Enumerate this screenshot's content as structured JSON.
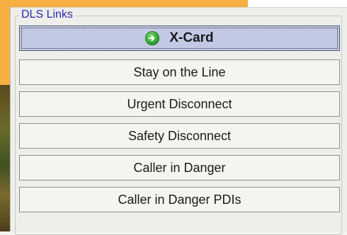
{
  "panel": {
    "legend": "DLS Links"
  },
  "buttons": [
    {
      "label": "X-Card",
      "icon": "arrow-right-circle-icon",
      "primary": true
    },
    {
      "label": "Stay on the Line"
    },
    {
      "label": "Urgent Disconnect"
    },
    {
      "label": "Safety Disconnect"
    },
    {
      "label": "Caller in Danger"
    },
    {
      "label": "Caller in Danger PDIs"
    }
  ],
  "colors": {
    "legend": "#2a2ab0",
    "primary_button_bg": "#c2c9e4",
    "background_orange": "#f6b042",
    "icon_green": "#31a532"
  }
}
